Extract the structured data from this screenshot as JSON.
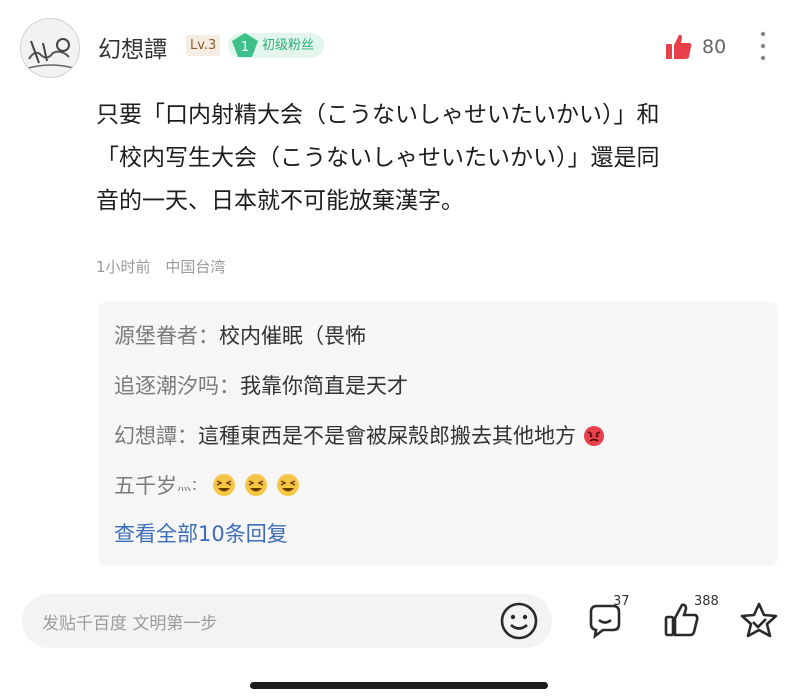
{
  "comment": {
    "username": "幻想譚",
    "level": "Lv.3",
    "fan_badge": {
      "number": "1",
      "label": "初级粉丝"
    },
    "like_count": "80",
    "text_lines": [
      "只要「口内射精大会（こうないしゃせいたいかい）」和",
      "「校内写生大会（こうないしゃせいたいかい）」還是同",
      "音的一天、日本就不可能放棄漢字。"
    ],
    "time": "1小时前",
    "location": "中国台湾"
  },
  "replies": [
    {
      "name": "源堡眷者：",
      "text": "校内催眠（畏怖",
      "emoji": ""
    },
    {
      "name": "追逐潮汐吗：",
      "text": "我靠你简直是天才",
      "emoji": ""
    },
    {
      "name": "幻想譚：",
      "text": "這種東西是不是會被屎殼郎搬去其他地方",
      "emoji": "angry-face-emoji"
    },
    {
      "name": "五千岁",
      "name_suffix": "灬：",
      "text": "",
      "emoji": "laughing-face-emoji x3"
    }
  ],
  "view_all_replies": "查看全部10条回复",
  "bottom_bar": {
    "placeholder": "发贴千百度 文明第一步",
    "comment_count": "37",
    "like_count": "388"
  },
  "colors": {
    "like_red": "#e8414b",
    "link_blue": "#3c6db7",
    "badge_green": "#2bb07a"
  }
}
